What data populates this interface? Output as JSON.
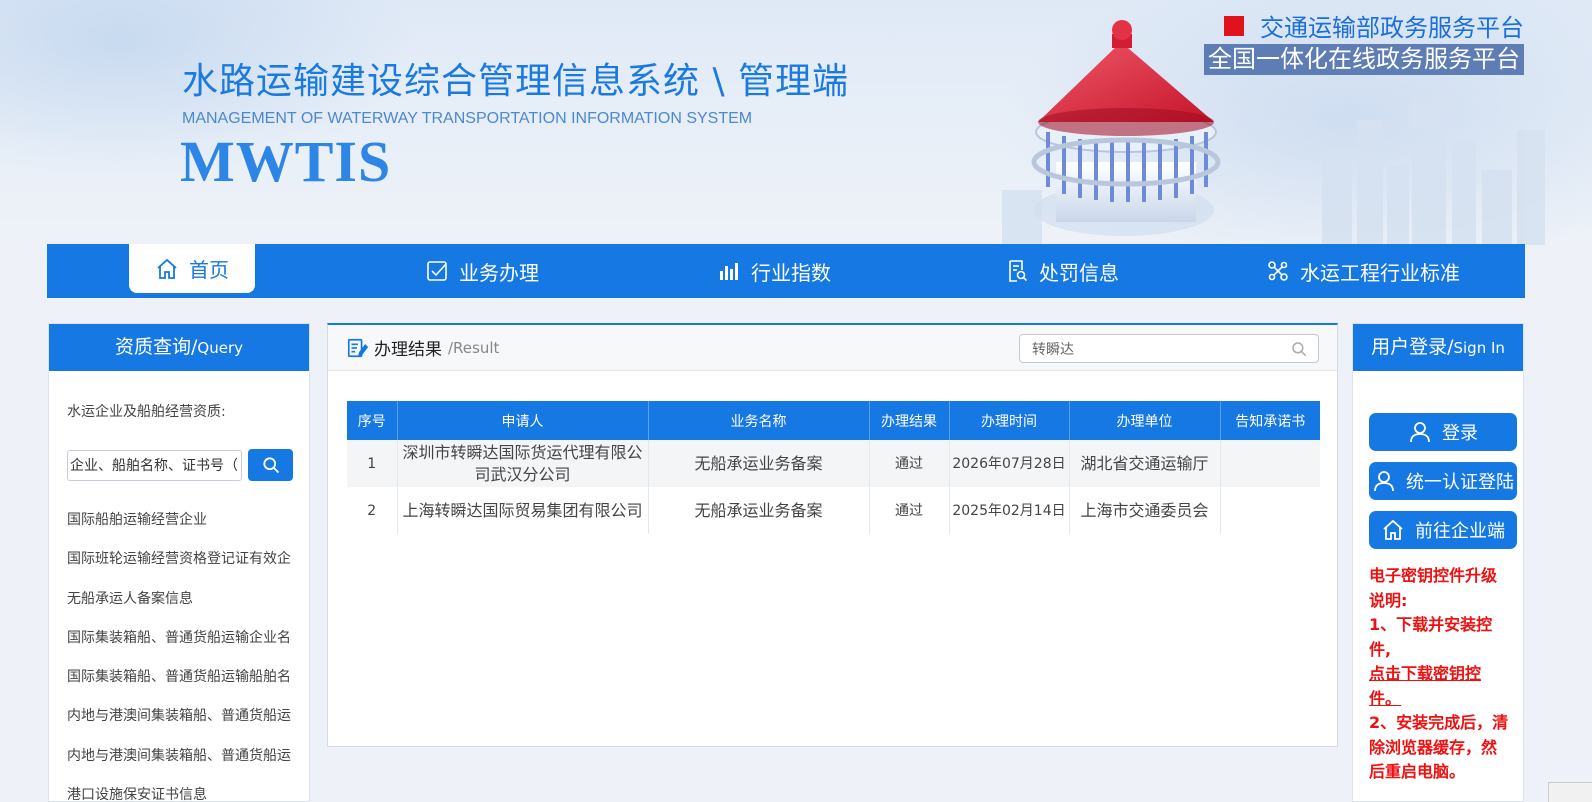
{
  "header": {
    "system_title_cn": "水路运输建设综合管理信息系统 \\ 管理端",
    "system_title_en": "MANAGEMENT OF WATERWAY TRANSPORTATION INFORMATION SYSTEM",
    "system_abbr": "MWTIS",
    "platform_top": "交通运输部政务服务平台",
    "platform_bottom": "全国一体化在线政务服务平台"
  },
  "nav": {
    "items": [
      {
        "label": "首页",
        "icon": "home-icon",
        "active": true
      },
      {
        "label": "业务办理",
        "icon": "check-form-icon",
        "active": false
      },
      {
        "label": "行业指数",
        "icon": "bar-chart-icon",
        "active": false
      },
      {
        "label": "处罚信息",
        "icon": "document-search-icon",
        "active": false
      },
      {
        "label": "水运工程行业标准",
        "icon": "tools-icon",
        "active": false
      }
    ]
  },
  "left_panel": {
    "title": "资质查询/",
    "title_en": "Query",
    "lead": "水运企业及船舶经营资质:",
    "search_value": "企业、船舶名称、证书号（",
    "links": [
      "国际船舶运输经营企业",
      "国际班轮运输经营资格登记证有效企业",
      "无船承运人备案信息",
      "国际集装箱船、普通货船运输企业名单",
      "国际集装箱船、普通货船运输船舶名单",
      "内地与港澳间集装箱船、普通货船运输企业",
      "内地与港澳间集装箱船、普通货船运输船舶",
      "港口设施保安证书信息"
    ]
  },
  "result": {
    "title": "办理结果",
    "subtitle": "/Result",
    "search_value": "转瞬达",
    "columns": [
      "序号",
      "申请人",
      "业务名称",
      "办理结果",
      "办理时间",
      "办理单位",
      "告知承诺书"
    ],
    "rows": [
      {
        "no": "1",
        "applicant": "深圳市转瞬达国际货运代理有限公司武汉分公司",
        "business": "无船承运业务备案",
        "status": "通过",
        "date": "2026年07月28日",
        "unit": "湖北省交通运输厅",
        "letter": ""
      },
      {
        "no": "2",
        "applicant": "上海转瞬达国际贸易集团有限公司",
        "business": "无船承运业务备案",
        "status": "通过",
        "date": "2025年02月14日",
        "unit": "上海市交通委员会",
        "letter": ""
      }
    ]
  },
  "right_panel": {
    "title": "用户登录/",
    "title_en": "Sign In",
    "buttons": [
      {
        "label": "登录",
        "icon": "user-icon"
      },
      {
        "label": "统一认证登陆",
        "icon": "user-icon"
      },
      {
        "label": "前往企业端",
        "icon": "home-icon"
      }
    ],
    "notice_title": "电子密钥控件升级说明:",
    "notice_step1": "1、下载并安装控件,",
    "notice_link": "点击下载密钥控件。",
    "notice_step2": "2、安装完成后，清除浏览器缓存，然后重启电脑。"
  },
  "colors": {
    "brand_blue": "#1578e3",
    "brand_red": "#e0121b",
    "notice_red": "#ee1111"
  }
}
